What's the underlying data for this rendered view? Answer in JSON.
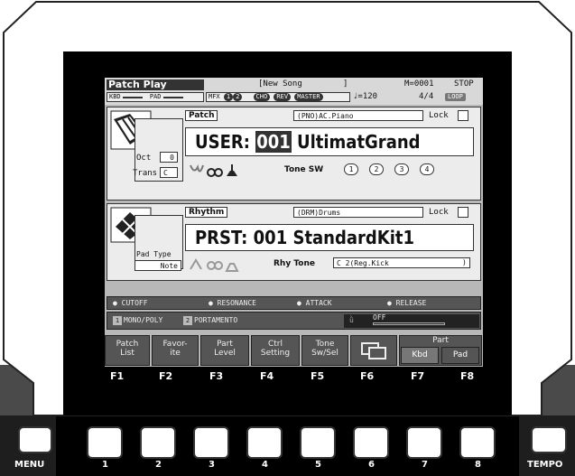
{
  "header": {
    "title": "Patch Play",
    "song": "[New Song",
    "song_end": "]",
    "measure": "M=0001",
    "state": "STOP",
    "kbd_label": "KBD",
    "pad_label": "PAD",
    "mfx_label": "MFX",
    "mfx1": "1",
    "mfx2": "2",
    "cho_label": "CHO",
    "rev_label": "REV",
    "master_label": "MASTER",
    "tempo": "♩=120",
    "time_sig": "4/4",
    "loop_label": "LOOP"
  },
  "patch": {
    "section_label": "Patch",
    "category_name": "(PNO)AC.Piano",
    "lock_label": "Lock",
    "bank": "USER:",
    "number": "001",
    "name": "UltimatGrand",
    "oct_label": "Oct",
    "oct_value": "0",
    "trans_label": "Trans",
    "trans_value": "C",
    "tone_sw_label": "Tone SW",
    "tone_buttons": [
      "1",
      "2",
      "3",
      "4"
    ]
  },
  "rhythm": {
    "section_label": "Rhythm",
    "category_name": "(DRM)Drums",
    "lock_label": "Lock",
    "bank": "PRST:",
    "number": "001",
    "name": "StandardKit1",
    "pad_type_label": "Pad Type",
    "pad_type_value": "Note",
    "rhy_tone_label": "Rhy Tone",
    "rhy_tone_value": "C 2(Reg.Kick",
    "rhy_tone_end": ")"
  },
  "controls": {
    "knobs": [
      "CUTOFF",
      "RESONANCE",
      "ATTACK",
      "RELEASE"
    ],
    "switch1_num": "1",
    "switch1_label": "MONO/POLY",
    "switch2_num": "2",
    "switch2_label": "PORTAMENTO",
    "d_beam_state": "OFF"
  },
  "function_buttons": {
    "f1": "Patch\nList",
    "f2": "Favor-\nite",
    "f3": "Part\nLevel",
    "f4": "Ctrl\nSetting",
    "f5": "Tone\nSw/Sel",
    "part_label": "Part",
    "kbd": "Kbd",
    "pad": "Pad"
  },
  "f_labels": [
    "F1",
    "F2",
    "F3",
    "F4",
    "F5",
    "F6",
    "F7",
    "F8"
  ],
  "hardware": {
    "menu_label": "MENU",
    "tempo_label": "TEMPO",
    "numbers": [
      "1",
      "2",
      "3",
      "4",
      "5",
      "6",
      "7",
      "8"
    ]
  },
  "colors": {
    "lcd_bg": "#b8b8b8",
    "panel_dark": "#333333",
    "bezel": "#000000"
  }
}
